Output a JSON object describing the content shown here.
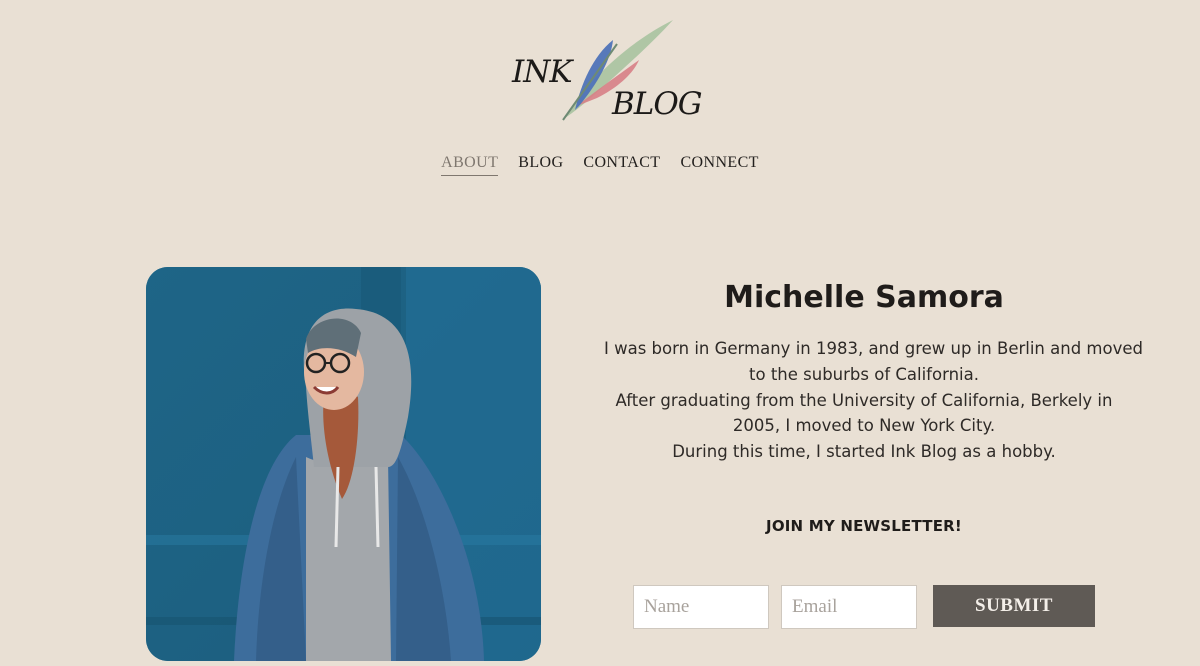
{
  "logo": {
    "word1": "INK",
    "word2": "BLOG"
  },
  "nav": {
    "items": [
      {
        "label": "ABOUT",
        "active": true
      },
      {
        "label": "BLOG",
        "active": false
      },
      {
        "label": "CONTACT",
        "active": false
      },
      {
        "label": "CONNECT",
        "active": false
      }
    ]
  },
  "profile": {
    "name": "Michelle Samora",
    "bio_lines": [
      "I was born in Germany in 1983, and grew up in Berlin and moved",
      "to the suburbs of California.",
      "After graduating from the University of California, Berkely in",
      "2005, I moved to New York City.",
      "During this time, I started Ink Blog as a hobby."
    ]
  },
  "newsletter": {
    "title": "JOIN MY NEWSLETTER!",
    "name_placeholder": "Name",
    "email_placeholder": "Email",
    "submit_label": "SUBMIT"
  },
  "colors": {
    "background": "#e9e0d4",
    "nav_active": "#7f776f",
    "submit_bg": "#5f5a55",
    "photo_wall": "#1f6b8c"
  }
}
